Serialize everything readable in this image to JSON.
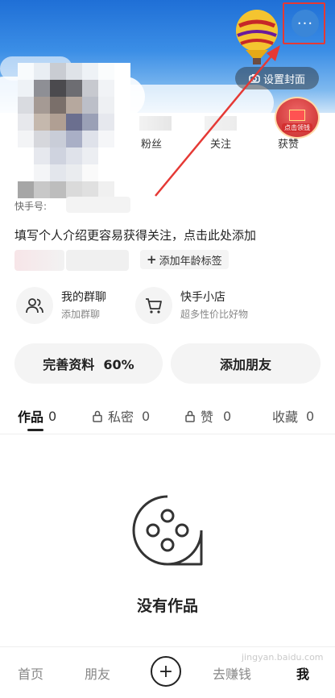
{
  "header": {
    "more_icon_text": "···",
    "set_cover_label": "设置封面",
    "camera_icon": "camera-icon"
  },
  "stats": {
    "fans_label": "粉丝",
    "follow_label": "关注",
    "likes_label": "获赞"
  },
  "badge": {
    "label": "点击领钱"
  },
  "profile": {
    "id_label": "快手号:",
    "intro": "填写个人介绍更容易获得关注，点击此处添加",
    "age_tag": "添加年龄标签"
  },
  "entries": [
    {
      "title": "我的群聊",
      "subtitle": "添加群聊",
      "icon": "group-icon"
    },
    {
      "title": "快手小店",
      "subtitle": "超多性价比好物",
      "icon": "cart-icon"
    }
  ],
  "buttons": {
    "complete_profile": "完善资料  60%",
    "add_friend": "添加朋友"
  },
  "profile_completion": 0.6,
  "tabs": [
    {
      "label": "作品",
      "count": "0"
    },
    {
      "label": "私密",
      "count": "0"
    },
    {
      "label": "赞",
      "count": "0"
    },
    {
      "label": "收藏",
      "count": "0"
    }
  ],
  "empty_state": {
    "text": "没有作品"
  },
  "bottom_nav": {
    "home": "首页",
    "friends": "朋友",
    "plus": "+",
    "earn": "去赚钱",
    "me": "我",
    "watermark": "jingyan.baidu.com"
  },
  "colors": {
    "annotation_red": "#e53935",
    "cover_blue": "#2f7fdc"
  }
}
